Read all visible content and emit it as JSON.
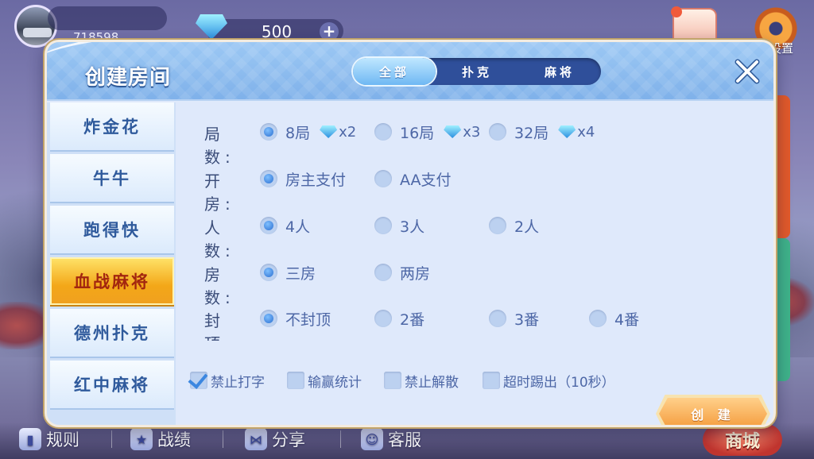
{
  "topbar": {
    "player_id": "718598",
    "gems": "500",
    "plus": "+",
    "settings_label": "设置"
  },
  "dialog": {
    "title": "创建房间",
    "tabs": [
      {
        "label": "全部",
        "active": true
      },
      {
        "label": "扑克",
        "active": false
      },
      {
        "label": "麻将",
        "active": false
      }
    ],
    "games": [
      {
        "label": "炸金花",
        "active": false
      },
      {
        "label": "牛牛",
        "active": false
      },
      {
        "label": "跑得快",
        "active": false
      },
      {
        "label": "血战麻将",
        "active": true
      },
      {
        "label": "德州扑克",
        "active": false
      },
      {
        "label": "红中麻将",
        "active": false
      }
    ],
    "rows": {
      "rounds": {
        "label": "局 数:",
        "options": [
          {
            "label": "8局",
            "cost": "x2",
            "selected": true
          },
          {
            "label": "16局",
            "cost": "x3",
            "selected": false
          },
          {
            "label": "32局",
            "cost": "x4",
            "selected": false
          }
        ]
      },
      "payment": {
        "label": "开 房:",
        "options": [
          {
            "label": "房主支付",
            "selected": true
          },
          {
            "label": "AA支付",
            "selected": false
          }
        ]
      },
      "players": {
        "label": "人 数:",
        "options": [
          {
            "label": "4人",
            "selected": true
          },
          {
            "label": "3人",
            "selected": false
          },
          {
            "label": "2人",
            "selected": false
          }
        ]
      },
      "rooms": {
        "label": "房 数:",
        "options": [
          {
            "label": "三房",
            "selected": true
          },
          {
            "label": "两房",
            "selected": false
          }
        ]
      },
      "cap": {
        "label": "封 顶:",
        "options": [
          {
            "label": "不封顶",
            "selected": true
          },
          {
            "label": "2番",
            "selected": false
          },
          {
            "label": "3番",
            "selected": false
          },
          {
            "label": "4番",
            "selected": false
          }
        ]
      }
    },
    "checkboxes": [
      {
        "label": "禁止打字",
        "checked": true
      },
      {
        "label": "输赢统计",
        "checked": false
      },
      {
        "label": "禁止解散",
        "checked": false
      },
      {
        "label": "超时踢出（10秒）",
        "checked": false
      }
    ],
    "create_label": "创 建"
  },
  "bottom_nav": [
    {
      "label": "规则",
      "icon": "rules-icon"
    },
    {
      "label": "战绩",
      "icon": "record-icon"
    },
    {
      "label": "分享",
      "icon": "share-icon"
    },
    {
      "label": "客服",
      "icon": "service-icon"
    }
  ],
  "shop_label": "商城",
  "colors": {
    "accent_blue": "#2f4f9a",
    "active_game": "#f3a718",
    "create_button": "#f49a3a"
  }
}
